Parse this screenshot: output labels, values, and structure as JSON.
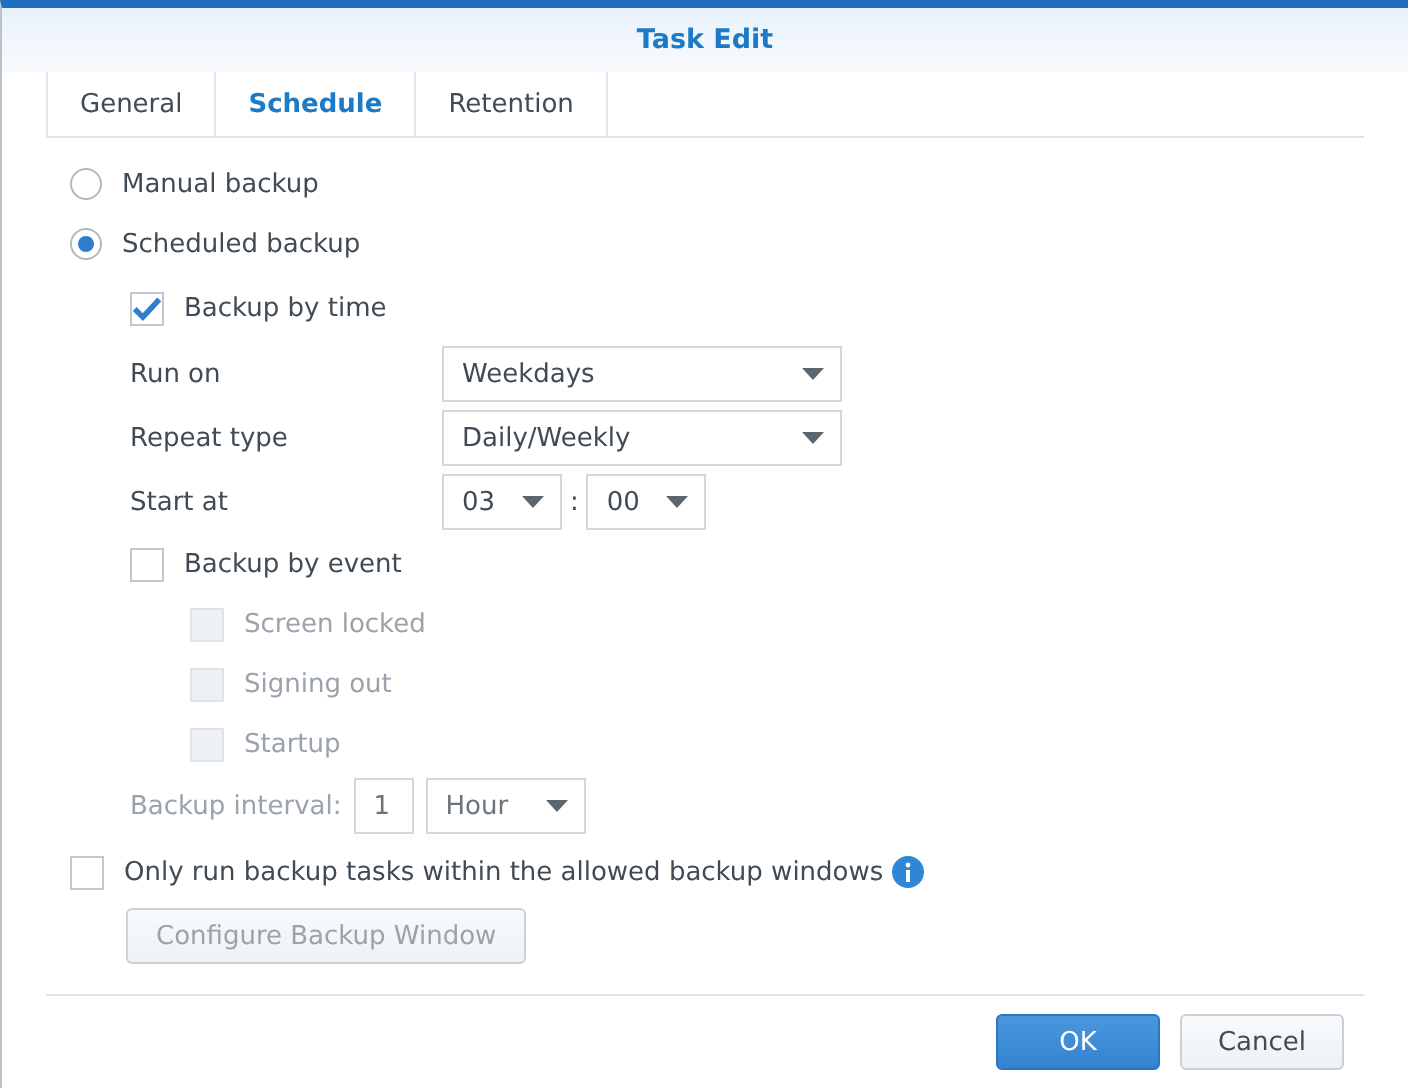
{
  "window": {
    "title": "Task Edit"
  },
  "tabs": [
    {
      "label": "General",
      "selected": false
    },
    {
      "label": "Schedule",
      "selected": true
    },
    {
      "label": "Retention",
      "selected": false
    }
  ],
  "modes": [
    {
      "label": "Manual backup",
      "selected": false
    },
    {
      "label": "Scheduled backup",
      "selected": true
    }
  ],
  "time_trigger": {
    "label": "Backup by time",
    "checked": true,
    "fields": [
      {
        "kind": "select",
        "label": "Run on",
        "value": "Weekdays"
      },
      {
        "kind": "select",
        "label": "Repeat type",
        "value": "Daily/Weekly"
      },
      {
        "kind": "time",
        "label": "Start at",
        "hour": "03",
        "separator": ":",
        "minute": "00"
      }
    ]
  },
  "event_trigger": {
    "label": "Backup by event",
    "checked": false,
    "events": [
      {
        "label": "Screen locked",
        "checked": false,
        "disabled": true
      },
      {
        "label": "Signing out",
        "checked": false,
        "disabled": true
      },
      {
        "label": "Startup",
        "checked": false,
        "disabled": true
      }
    ],
    "interval": {
      "label": "Backup interval:",
      "value": "1",
      "unit": "Hour",
      "disabled": true
    }
  },
  "window_option": {
    "label": "Only run backup tasks within the allowed backup windows",
    "checked": false
  },
  "configure_button": {
    "label": "Configure Backup Window",
    "disabled": true
  },
  "buttons": [
    {
      "label": "OK",
      "primary": true
    },
    {
      "label": "Cancel",
      "primary": false
    }
  ]
}
